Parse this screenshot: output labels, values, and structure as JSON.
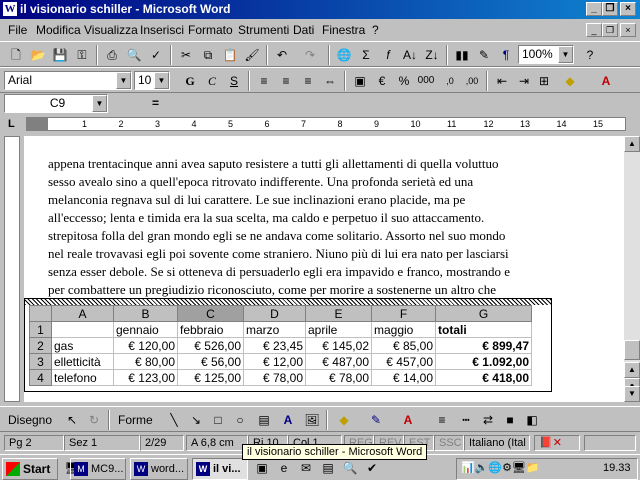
{
  "window": {
    "title": "il visionario schiller - Microsoft Word",
    "icon": "word-document-icon"
  },
  "menu": [
    "File",
    "Modifica",
    "Visualizza",
    "Inserisci",
    "Formato",
    "Strumenti",
    "Dati",
    "Finestra",
    "?"
  ],
  "toolbar": {
    "zoom": "100%"
  },
  "format": {
    "font": "Arial",
    "size": "10"
  },
  "formula": {
    "namebox": "C9",
    "equals": "="
  },
  "ruler": {
    "ticks": [
      "1",
      "2",
      "3",
      "4",
      "5",
      "6",
      "7",
      "8",
      "9",
      "10",
      "11",
      "12",
      "13",
      "14",
      "15"
    ],
    "left_marker": "L"
  },
  "document": {
    "lines": [
      "appena trentacinque anni avea saputo resistere a tutti gli allettamenti di quella voluttuo",
      "sesso avealo sino a quell'epoca ritrovato indifferente. Una profonda serietà ed una",
      "melanconia regnava sul di lui carattere. Le sue inclinazioni erano placide, ma pe",
      "all'eccesso; lenta e timida era la sua scelta, ma caldo e perpetuo il suo attaccamento.",
      "strepitosa folla del gran mondo egli se ne andava come solitario. Assorto nel suo mondo",
      "nel reale trovavasi egli poi sovente come straniero. Niuno più di lui era nato per lasciarsi",
      "senza esser debole. Se si otteneva di persuaderlo egli era impavido e franco, mostrando e",
      "per combattere un pregiudizio riconosciuto, come per morire a sostenerne un altro che"
    ]
  },
  "sheet": {
    "cols": [
      "A",
      "B",
      "C",
      "D",
      "E",
      "F",
      "G"
    ],
    "rows": [
      {
        "num": "1",
        "cells": [
          "",
          "gennaio",
          "febbraio",
          "marzo",
          "aprile",
          "maggio",
          "totali"
        ]
      },
      {
        "num": "2",
        "cells": [
          "gas",
          "€ 120,00",
          "€ 526,00",
          "€ 23,45",
          "€ 145,02",
          "€ 85,00",
          "€ 899,47"
        ]
      },
      {
        "num": "3",
        "cells": [
          "elletticità",
          "€ 80,00",
          "€ 56,00",
          "€ 12,00",
          "€ 487,00",
          "€ 457,00",
          "€ 1.092,00"
        ]
      },
      {
        "num": "4",
        "cells": [
          "telefono",
          "€ 123,00",
          "€ 125,00",
          "€ 78,00",
          "€ 78,00",
          "€ 14,00",
          "€ 418,00"
        ]
      }
    ]
  },
  "drawing": {
    "disegno": "Disegno",
    "forme": "Forme"
  },
  "status": {
    "page": "Pg 2",
    "section": "Sez 1",
    "pages": "2/29",
    "at": "A 6,8 cm",
    "line": "Ri 10",
    "col": "Col 1",
    "rec": "REG",
    "rev": "REV",
    "est": "EST",
    "ssc": "SSC",
    "lang": "Italiano (Ital"
  },
  "tooltip": "il visionario schiller - Microsoft Word",
  "taskbar": {
    "start": "Start",
    "tasks": [
      "MC9...",
      "word...",
      "il vi..."
    ],
    "clock": "19.33"
  }
}
